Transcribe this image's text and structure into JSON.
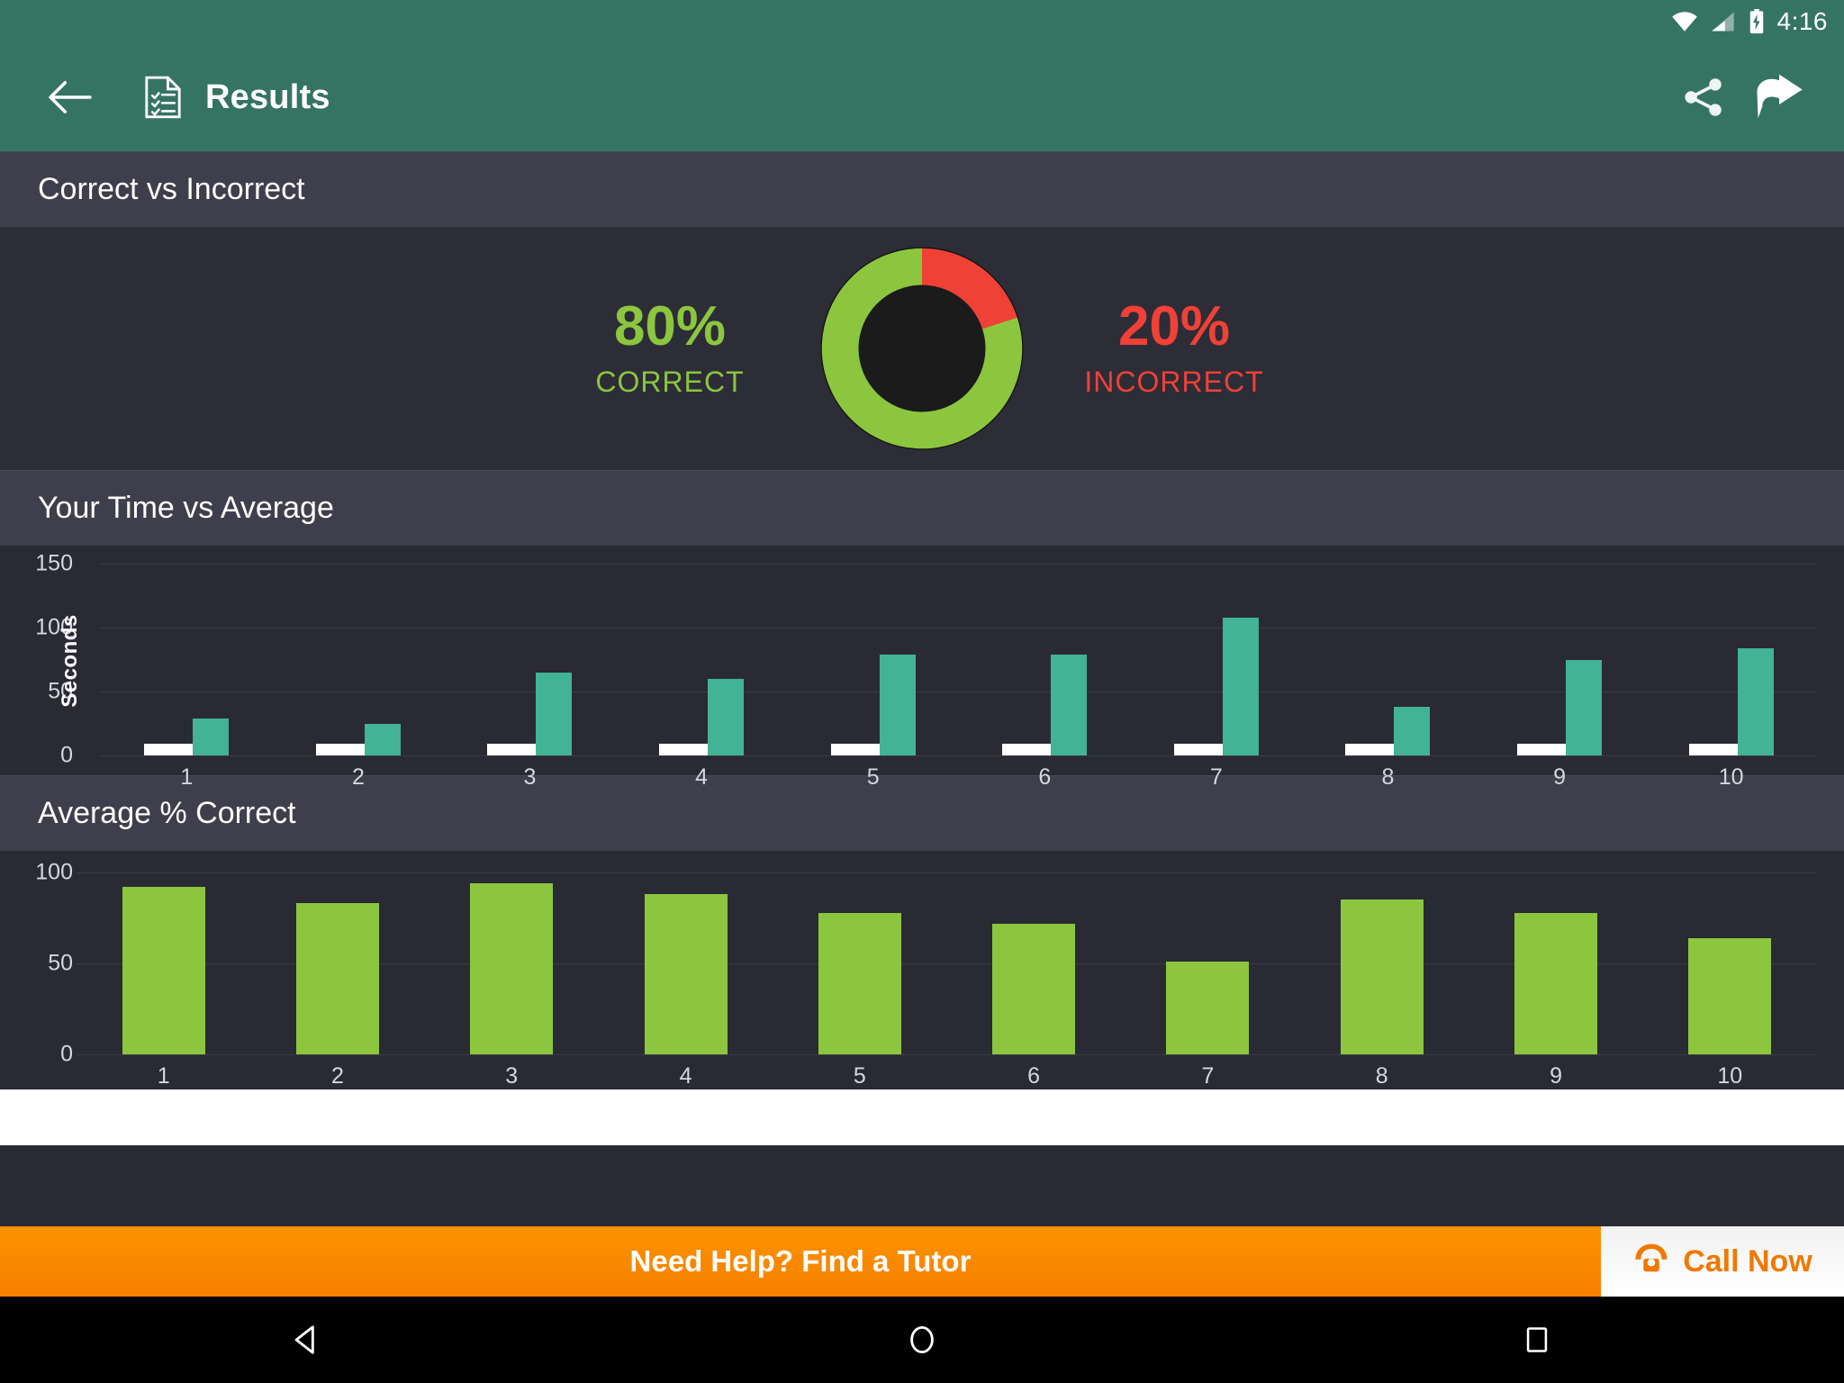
{
  "status_bar": {
    "time": "4:16",
    "icons": [
      "wifi-icon",
      "cellular-signal-icon",
      "battery-charging-icon"
    ]
  },
  "app_bar": {
    "back_icon": "back-arrow-icon",
    "doc_icon": "results-document-icon",
    "title": "Results",
    "share_icon": "share-icon",
    "next_icon": "forward-arrow-icon"
  },
  "sections": {
    "correct_vs_incorrect": {
      "heading": "Correct vs Incorrect",
      "correct_pct": "80%",
      "correct_label": "CORRECT",
      "incorrect_pct": "20%",
      "incorrect_label": "INCORRECT"
    },
    "time_vs_average": {
      "heading": "Your Time vs Average"
    },
    "average_correct": {
      "heading": "Average % Correct"
    }
  },
  "banner": {
    "message": "Need Help? Find a Tutor",
    "call_label": "Call Now",
    "phone_icon": "telephone-icon"
  },
  "nav_bar": {
    "back": "nav-back-icon",
    "home": "nav-home-icon",
    "recents": "nav-recents-icon"
  },
  "colors": {
    "accent_green": "#8cc63e",
    "accent_red": "#ef4136",
    "teal_bar": "#42b394",
    "appbar": "#357462",
    "banner_orange": "#f77f00",
    "panel_bg": "#2a2a35",
    "section_bg": "#3e3e4c"
  },
  "chart_data": [
    {
      "type": "pie",
      "title": "Correct vs Incorrect",
      "labels": [
        "CORRECT",
        "INCORRECT"
      ],
      "values": [
        80,
        20
      ],
      "colors": [
        "#8cc63e",
        "#ef4136"
      ],
      "donut": true,
      "legend": "sides"
    },
    {
      "type": "bar",
      "title": "Your Time vs Average",
      "categories": [
        "1",
        "2",
        "3",
        "4",
        "5",
        "6",
        "7",
        "8",
        "9",
        "10"
      ],
      "series": [
        {
          "name": "Average",
          "color": "#ffffff",
          "values": [
            9,
            9,
            9,
            9,
            9,
            9,
            9,
            9,
            9,
            9
          ]
        },
        {
          "name": "Your Time",
          "color": "#42b394",
          "values": [
            29,
            25,
            65,
            60,
            79,
            79,
            108,
            38,
            75,
            84
          ]
        }
      ],
      "xlabel": "",
      "ylabel": "Seconds",
      "yticks": [
        0,
        50,
        100,
        150
      ],
      "ylim": [
        0,
        150
      ],
      "grid": true,
      "legend": "none"
    },
    {
      "type": "bar",
      "title": "Average % Correct",
      "categories": [
        "1",
        "2",
        "3",
        "4",
        "5",
        "6",
        "7",
        "8",
        "9",
        "10"
      ],
      "values": [
        92,
        83,
        94,
        88,
        78,
        72,
        51,
        85,
        78,
        64
      ],
      "color": "#8cc63e",
      "xlabel": "",
      "ylabel": "",
      "yticks": [
        0,
        50,
        100
      ],
      "ylim": [
        0,
        105
      ],
      "grid": true,
      "legend": "none"
    }
  ]
}
